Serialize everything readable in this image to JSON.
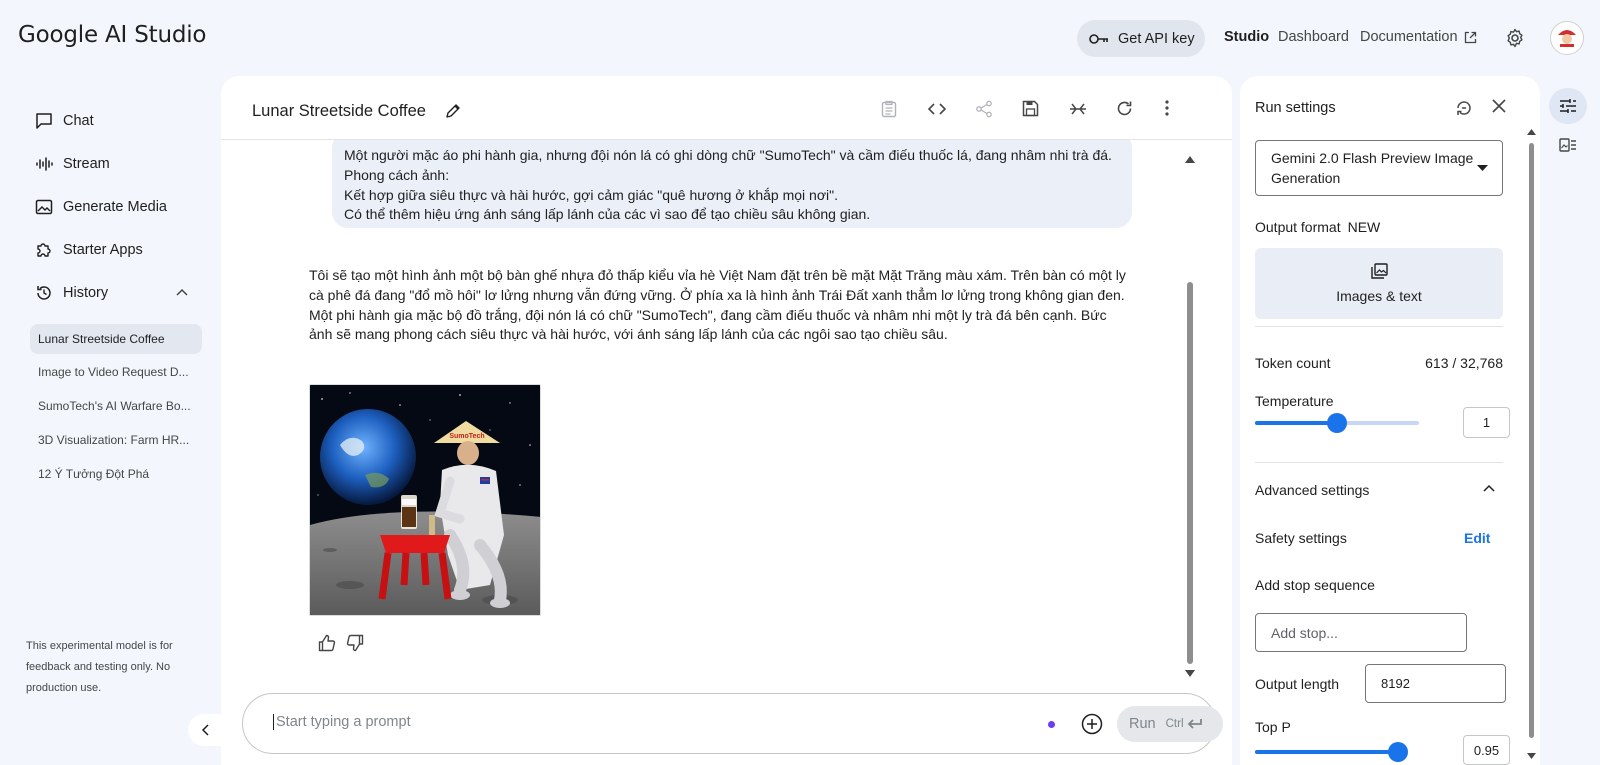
{
  "app": {
    "logo_text": "Google AI Studio",
    "api_key_label": "Get API key",
    "nav": {
      "studio": "Studio",
      "dashboard": "Dashboard",
      "documentation": "Documentation"
    }
  },
  "sidebar": {
    "items": [
      {
        "label": "Chat",
        "icon": "chat-icon"
      },
      {
        "label": "Stream",
        "icon": "stream-icon"
      },
      {
        "label": "Generate Media",
        "icon": "image-icon"
      },
      {
        "label": "Starter Apps",
        "icon": "puzzle-icon"
      },
      {
        "label": "History",
        "icon": "history-icon"
      }
    ],
    "history": [
      "Lunar Streetside Coffee",
      "Image to Video Request D...",
      "SumoTech's AI Warfare Bo...",
      "3D Visualization: Farm HR...",
      "12 Ý Tưởng Đột Phá"
    ],
    "footer_note": "This experimental model is for feedback and testing only. No production use."
  },
  "chat": {
    "title": "Lunar Streetside Coffee",
    "user_message_lines": [
      "Một người mặc áo phi hành gia, nhưng đội nón lá có ghi dòng chữ \"SumoTech\" và cầm điếu thuốc lá, đang nhâm nhi trà đá.",
      "Phong cách ảnh:",
      "Kết hợp giữa siêu thực và hài hước, gợi cảm giác \"quê hương ở khắp mọi nơi\".",
      "Có thể thêm hiệu ứng ánh sáng lấp lánh của các vì sao để tạo chiều sâu không gian."
    ],
    "model_response": "Tôi sẽ tạo một hình ảnh một bộ bàn ghế nhựa đỏ thấp kiểu vỉa hè Việt Nam đặt trên bề mặt Mặt Trăng màu xám. Trên bàn có một ly cà phê đá đang \"đổ mồ hôi\" lơ lửng nhưng vẫn đứng vững. Ở phía xa là hình ảnh Trái Đất xanh thẳm lơ lửng trong không gian đen. Một phi hành gia mặc bộ đồ trắng, đội nón lá có chữ \"SumoTech\", đang cầm điếu thuốc và nhâm nhi một ly trà đá bên cạnh. Bức ảnh sẽ mang phong cách siêu thực và hài hước, với ánh sáng lấp lánh của các ngôi sao tạo chiều sâu.",
    "image_hat_text": "SumoTech",
    "prompt_placeholder": "Start typing a prompt",
    "run_label": "Run",
    "run_shortcut": "Ctrl"
  },
  "settings": {
    "title": "Run settings",
    "model": "Gemini 2.0 Flash Preview Image Generation",
    "output_format_label": "Output format",
    "output_format_badge": "NEW",
    "output_format_value": "Images & text",
    "token_count_label": "Token count",
    "token_count_value": "613 / 32,768",
    "temperature_label": "Temperature",
    "temperature_value": "1",
    "temperature_fraction": 0.5,
    "advanced_label": "Advanced settings",
    "safety_label": "Safety settings",
    "safety_edit": "Edit",
    "stop_sequence_label": "Add stop sequence",
    "stop_sequence_placeholder": "Add stop...",
    "output_length_label": "Output length",
    "output_length_value": "8192",
    "top_p_label": "Top P",
    "top_p_value": "0.95",
    "top_p_fraction": 0.95
  },
  "colors": {
    "accent": "#1a73e8",
    "panel_bg": "#ffffff",
    "page_bg": "#f3f6fc",
    "bubble_bg": "#eaeff8"
  }
}
